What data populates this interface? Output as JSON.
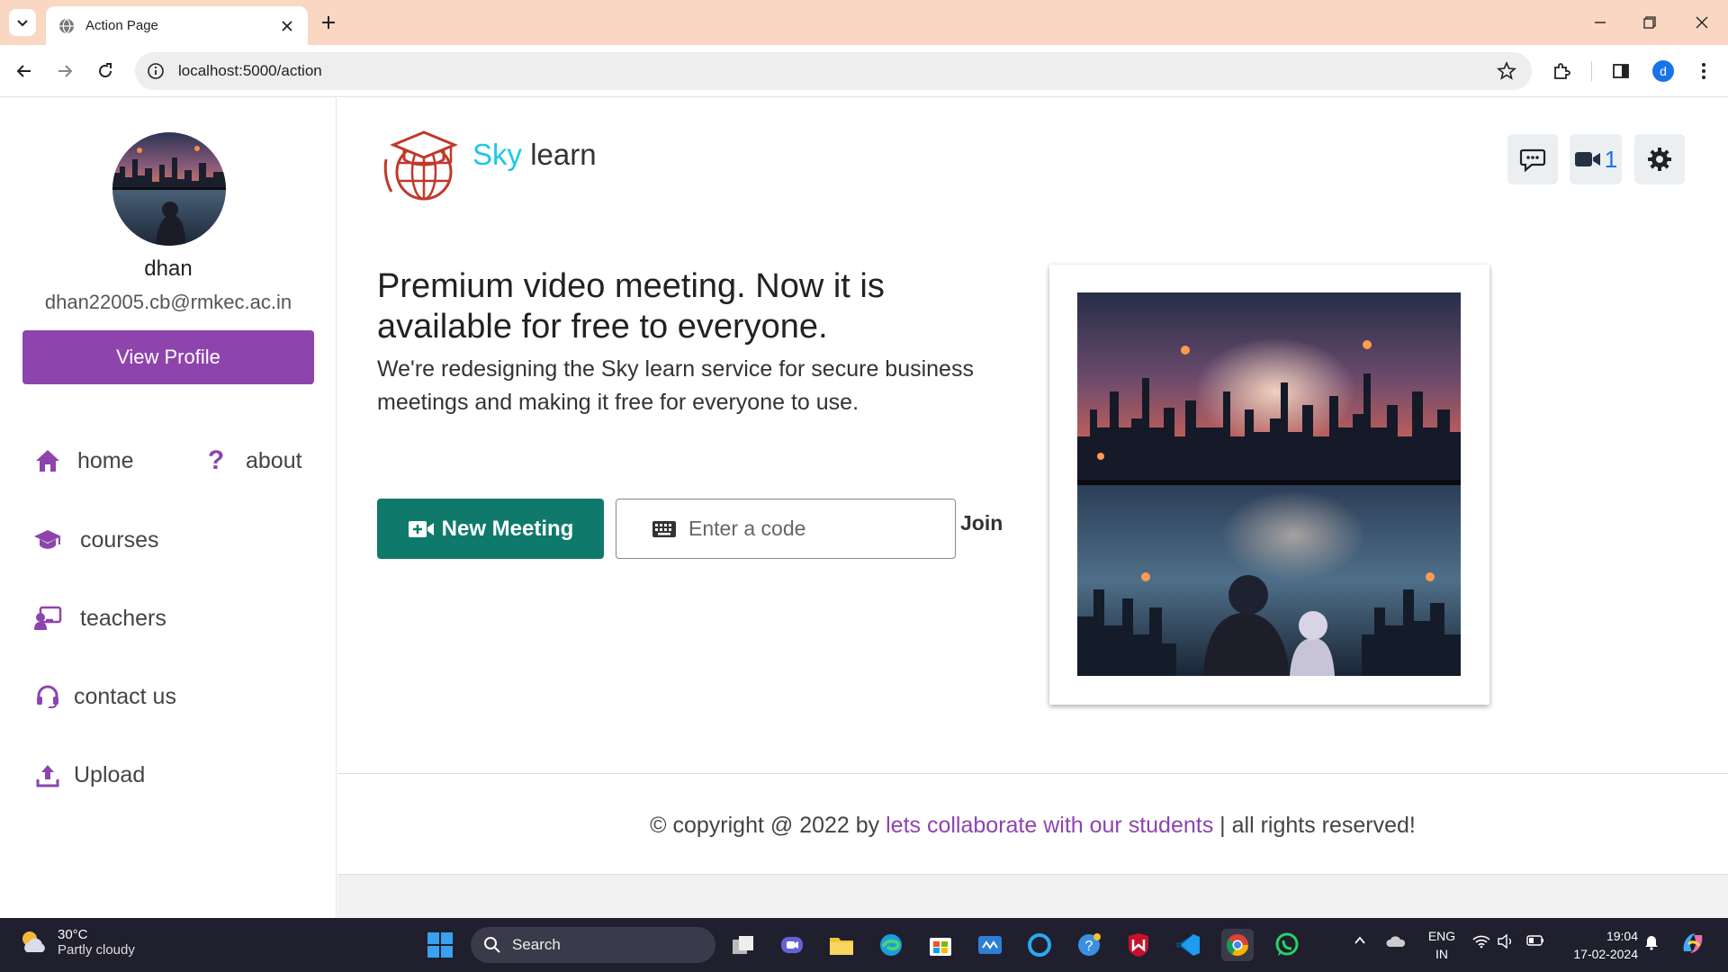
{
  "browser": {
    "tab_title": "Action Page",
    "url": "localhost:5000/action",
    "profile_initial": "d"
  },
  "sidebar": {
    "user_name": "dhan",
    "user_email": "dhan22005.cb@rmkec.ac.in",
    "view_profile_label": "View Profile",
    "nav": {
      "home": "home",
      "about": "about",
      "courses": "courses",
      "teachers": "teachers",
      "contact": "contact us",
      "upload": "Upload"
    }
  },
  "header": {
    "brand_sky": "Sky",
    "brand_learn": "learn",
    "video_count": "1"
  },
  "hero": {
    "headline": "Premium video meeting. Now it is available for free to everyone.",
    "subtext": "We're redesigning the Sky learn service for secure business meetings and making it free for everyone to use.",
    "new_meeting_label": "New Meeting",
    "code_placeholder": "Enter a code",
    "join_label": "Join"
  },
  "footer": {
    "prefix": "© copyright @ 2022 by ",
    "link": "lets collaborate with our students",
    "suffix": " | all rights reserved!"
  },
  "taskbar": {
    "temperature": "30°C",
    "weather": "Partly cloudy",
    "search_label": "Search",
    "lang_line1": "ENG",
    "lang_line2": "IN",
    "time": "19:04",
    "date": "17-02-2024"
  },
  "colors": {
    "accent_purple": "#8e44ad",
    "brand_cyan": "#1cc8e6",
    "meeting_green": "#0f7a6c",
    "tabbar": "#f9d7c2"
  }
}
